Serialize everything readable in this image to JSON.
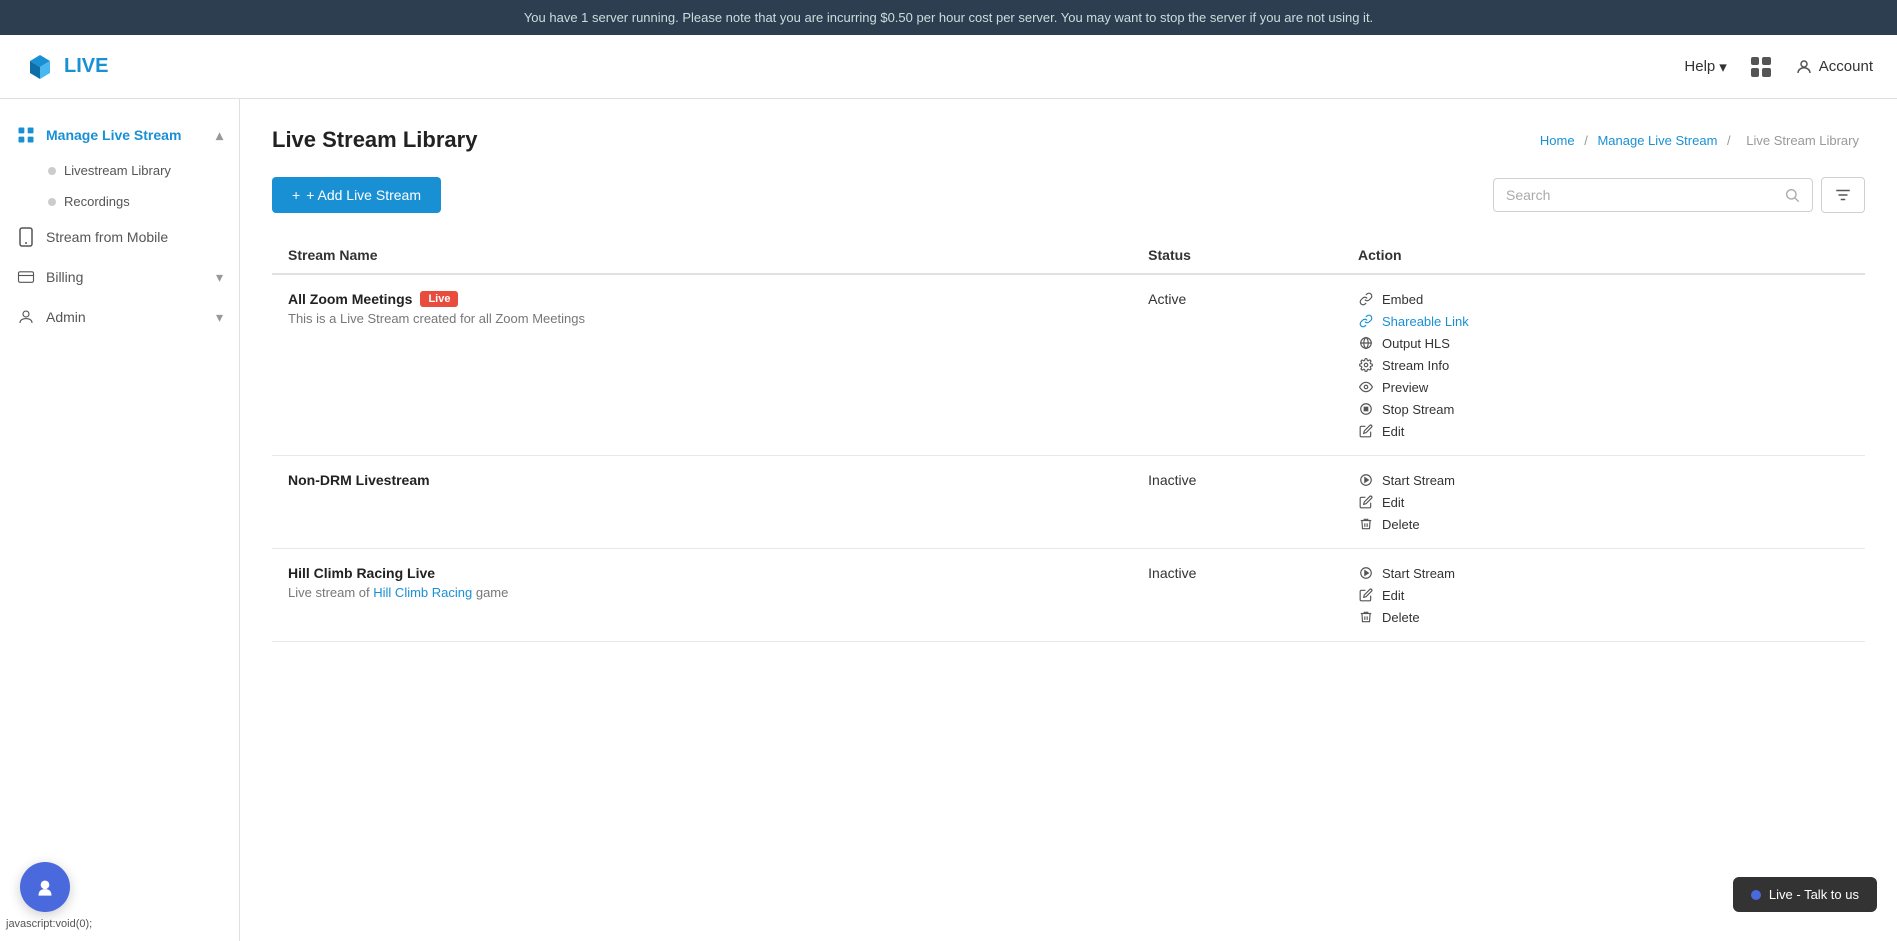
{
  "banner": {
    "text": "You have 1 server running. Please note that you are incurring $0.50 per hour cost per server. You may want to stop the server if you are not using it."
  },
  "header": {
    "logo_text": "LIVE",
    "help_label": "Help",
    "account_label": "Account"
  },
  "sidebar": {
    "main_item_label": "Manage Live Stream",
    "sub_items": [
      {
        "label": "Livestream Library"
      },
      {
        "label": "Recordings"
      }
    ],
    "standalone_items": [
      {
        "label": "Stream from Mobile",
        "icon": "mobile"
      },
      {
        "label": "Billing",
        "icon": "billing"
      },
      {
        "label": "Admin",
        "icon": "admin"
      }
    ]
  },
  "breadcrumb": {
    "home": "Home",
    "manage": "Manage Live Stream",
    "current": "Live Stream Library"
  },
  "page": {
    "title": "Live Stream Library",
    "add_btn": "+ Add Live Stream",
    "search_placeholder": "Search",
    "columns": {
      "stream_name": "Stream Name",
      "status": "Status",
      "action": "Action"
    }
  },
  "streams": [
    {
      "id": 1,
      "name": "All Zoom Meetings",
      "badge": "Live",
      "description": "This is a Live Stream created for all Zoom Meetings",
      "status": "Active",
      "actions": [
        {
          "label": "Embed",
          "type": "normal",
          "icon": "link"
        },
        {
          "label": "Shareable Link",
          "type": "link",
          "icon": "link"
        },
        {
          "label": "Output HLS",
          "type": "normal",
          "icon": "globe"
        },
        {
          "label": "Stream Info",
          "type": "normal",
          "icon": "gear"
        },
        {
          "label": "Preview",
          "type": "normal",
          "icon": "eye"
        },
        {
          "label": "Stop Stream",
          "type": "normal",
          "icon": "stop"
        },
        {
          "label": "Edit",
          "type": "normal",
          "icon": "edit"
        }
      ]
    },
    {
      "id": 2,
      "name": "Non-DRM Livestream",
      "badge": null,
      "description": "",
      "status": "Inactive",
      "actions": [
        {
          "label": "Start Stream",
          "type": "normal",
          "icon": "play"
        },
        {
          "label": "Edit",
          "type": "normal",
          "icon": "edit"
        },
        {
          "label": "Delete",
          "type": "normal",
          "icon": "trash"
        }
      ]
    },
    {
      "id": 3,
      "name": "Hill Climb Racing Live",
      "badge": null,
      "description": "Live stream of Hill Climb Racing game",
      "desc_link": "Hill Climb Racing",
      "status": "Inactive",
      "actions": [
        {
          "label": "Start Stream",
          "type": "normal",
          "icon": "play"
        },
        {
          "label": "Edit",
          "type": "normal",
          "icon": "edit"
        },
        {
          "label": "Delete",
          "type": "normal",
          "icon": "trash"
        }
      ]
    }
  ],
  "chat": {
    "label": "Live - Talk to us"
  },
  "statusbar": {
    "text": "javascript:void(0);"
  }
}
